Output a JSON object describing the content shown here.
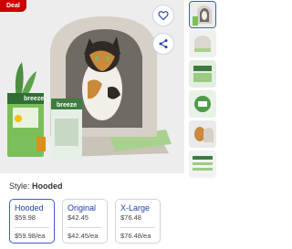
{
  "product_image": {
    "badge": "Deal",
    "package_text": "breeze",
    "bag_text": "breeze"
  },
  "actions": {
    "favorite_icon": "heart-icon",
    "share_icon": "share-icon"
  },
  "style": {
    "label": "Style:",
    "value": "Hooded"
  },
  "variants": [
    {
      "name": "Hooded",
      "price": "$59.98",
      "each": "$59.98/ea",
      "selected": true
    },
    {
      "name": "Original",
      "price": "$42.45",
      "each": "$42.45/ea",
      "selected": false
    },
    {
      "name": "X-Large",
      "price": "$76.48",
      "each": "$76.48/ea",
      "selected": false
    }
  ],
  "colors": {
    "accent": "#3a5bd9",
    "deal": "#cc0000",
    "variant_text": "#1f3fa8"
  }
}
